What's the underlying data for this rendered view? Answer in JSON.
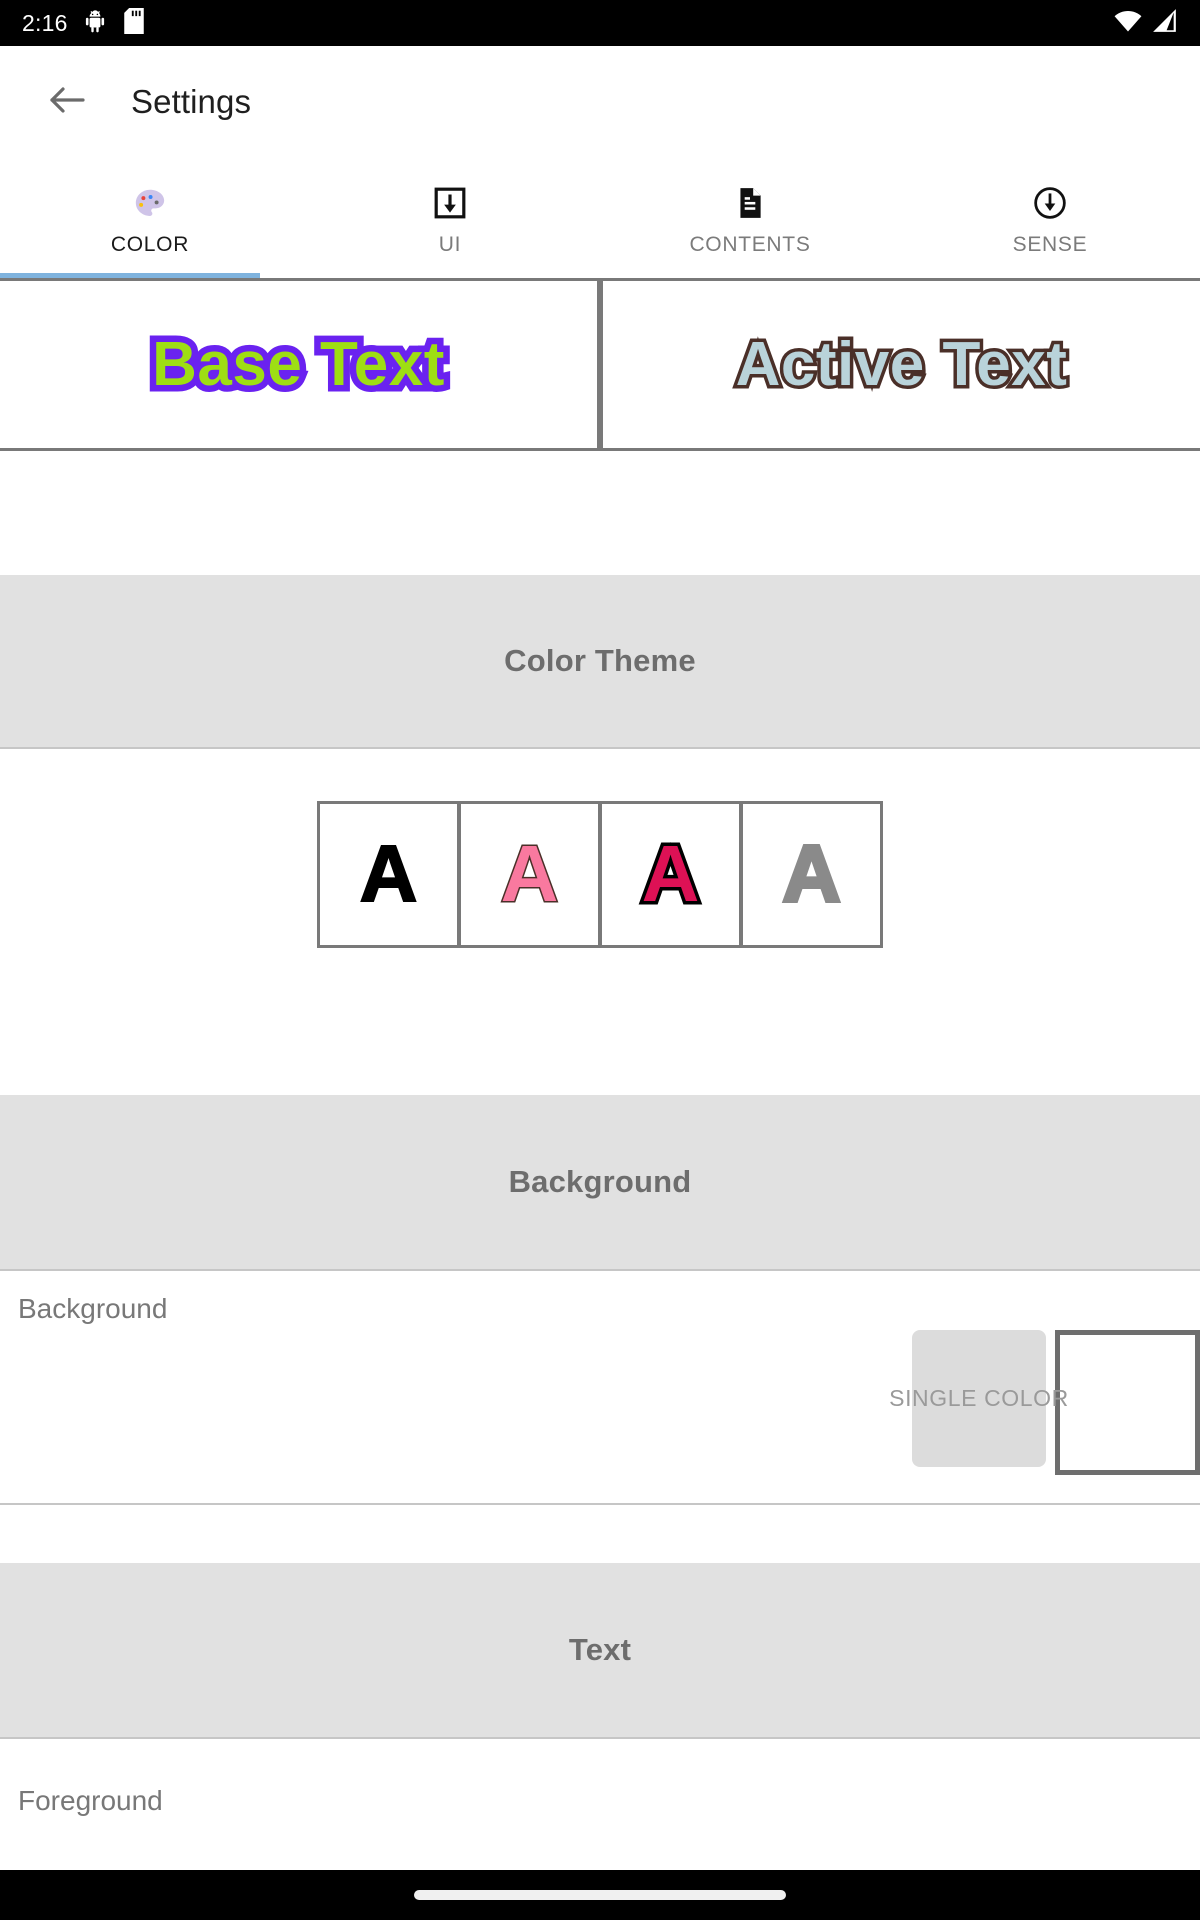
{
  "status_bar": {
    "clock": "2:16",
    "icons_left": [
      "android-debug-icon",
      "sd-card-icon"
    ],
    "icons_right": [
      "wifi-icon",
      "cellular-signal-icon"
    ]
  },
  "app_bar": {
    "back_icon": "back-arrow-icon",
    "title": "Settings"
  },
  "tabs": {
    "active_index": 0,
    "indicator_color": "#7fb3de",
    "items": [
      {
        "label": "COLOR",
        "icon": "palette-icon",
        "active": true
      },
      {
        "label": "UI",
        "icon": "download-box-icon",
        "active": false
      },
      {
        "label": "CONTENTS",
        "icon": "document-icon",
        "active": false
      },
      {
        "label": "SENSE",
        "icon": "download-circle-icon",
        "active": false
      }
    ]
  },
  "preview": {
    "cards": [
      {
        "text": "Base Text",
        "fill": "#9ede13",
        "stroke": "#6a22f0"
      },
      {
        "text": "Active Text",
        "fill": "#b9d3da",
        "stroke": "#4a2f28"
      }
    ]
  },
  "sections": {
    "color_theme": {
      "title": "Color Theme",
      "swatches": [
        {
          "letter": "A",
          "fill": "#000000",
          "stroke": "#000000"
        },
        {
          "letter": "A",
          "fill": "#f9799f",
          "stroke": "#4a2f28"
        },
        {
          "letter": "A",
          "fill": "#dd1155",
          "stroke": "#000000"
        },
        {
          "letter": "A",
          "fill": "#8a8a8a",
          "stroke": "#8a8a8a"
        }
      ]
    },
    "background": {
      "title": "Background",
      "rows": [
        {
          "label": "Background",
          "button_label": "SINGLE COLOR",
          "swatch_color": "#ffffff"
        }
      ]
    },
    "text": {
      "title": "Text",
      "rows": [
        {
          "label": "Foreground"
        }
      ]
    }
  },
  "nav_bar": {
    "handle": "home-gesture-handle"
  }
}
